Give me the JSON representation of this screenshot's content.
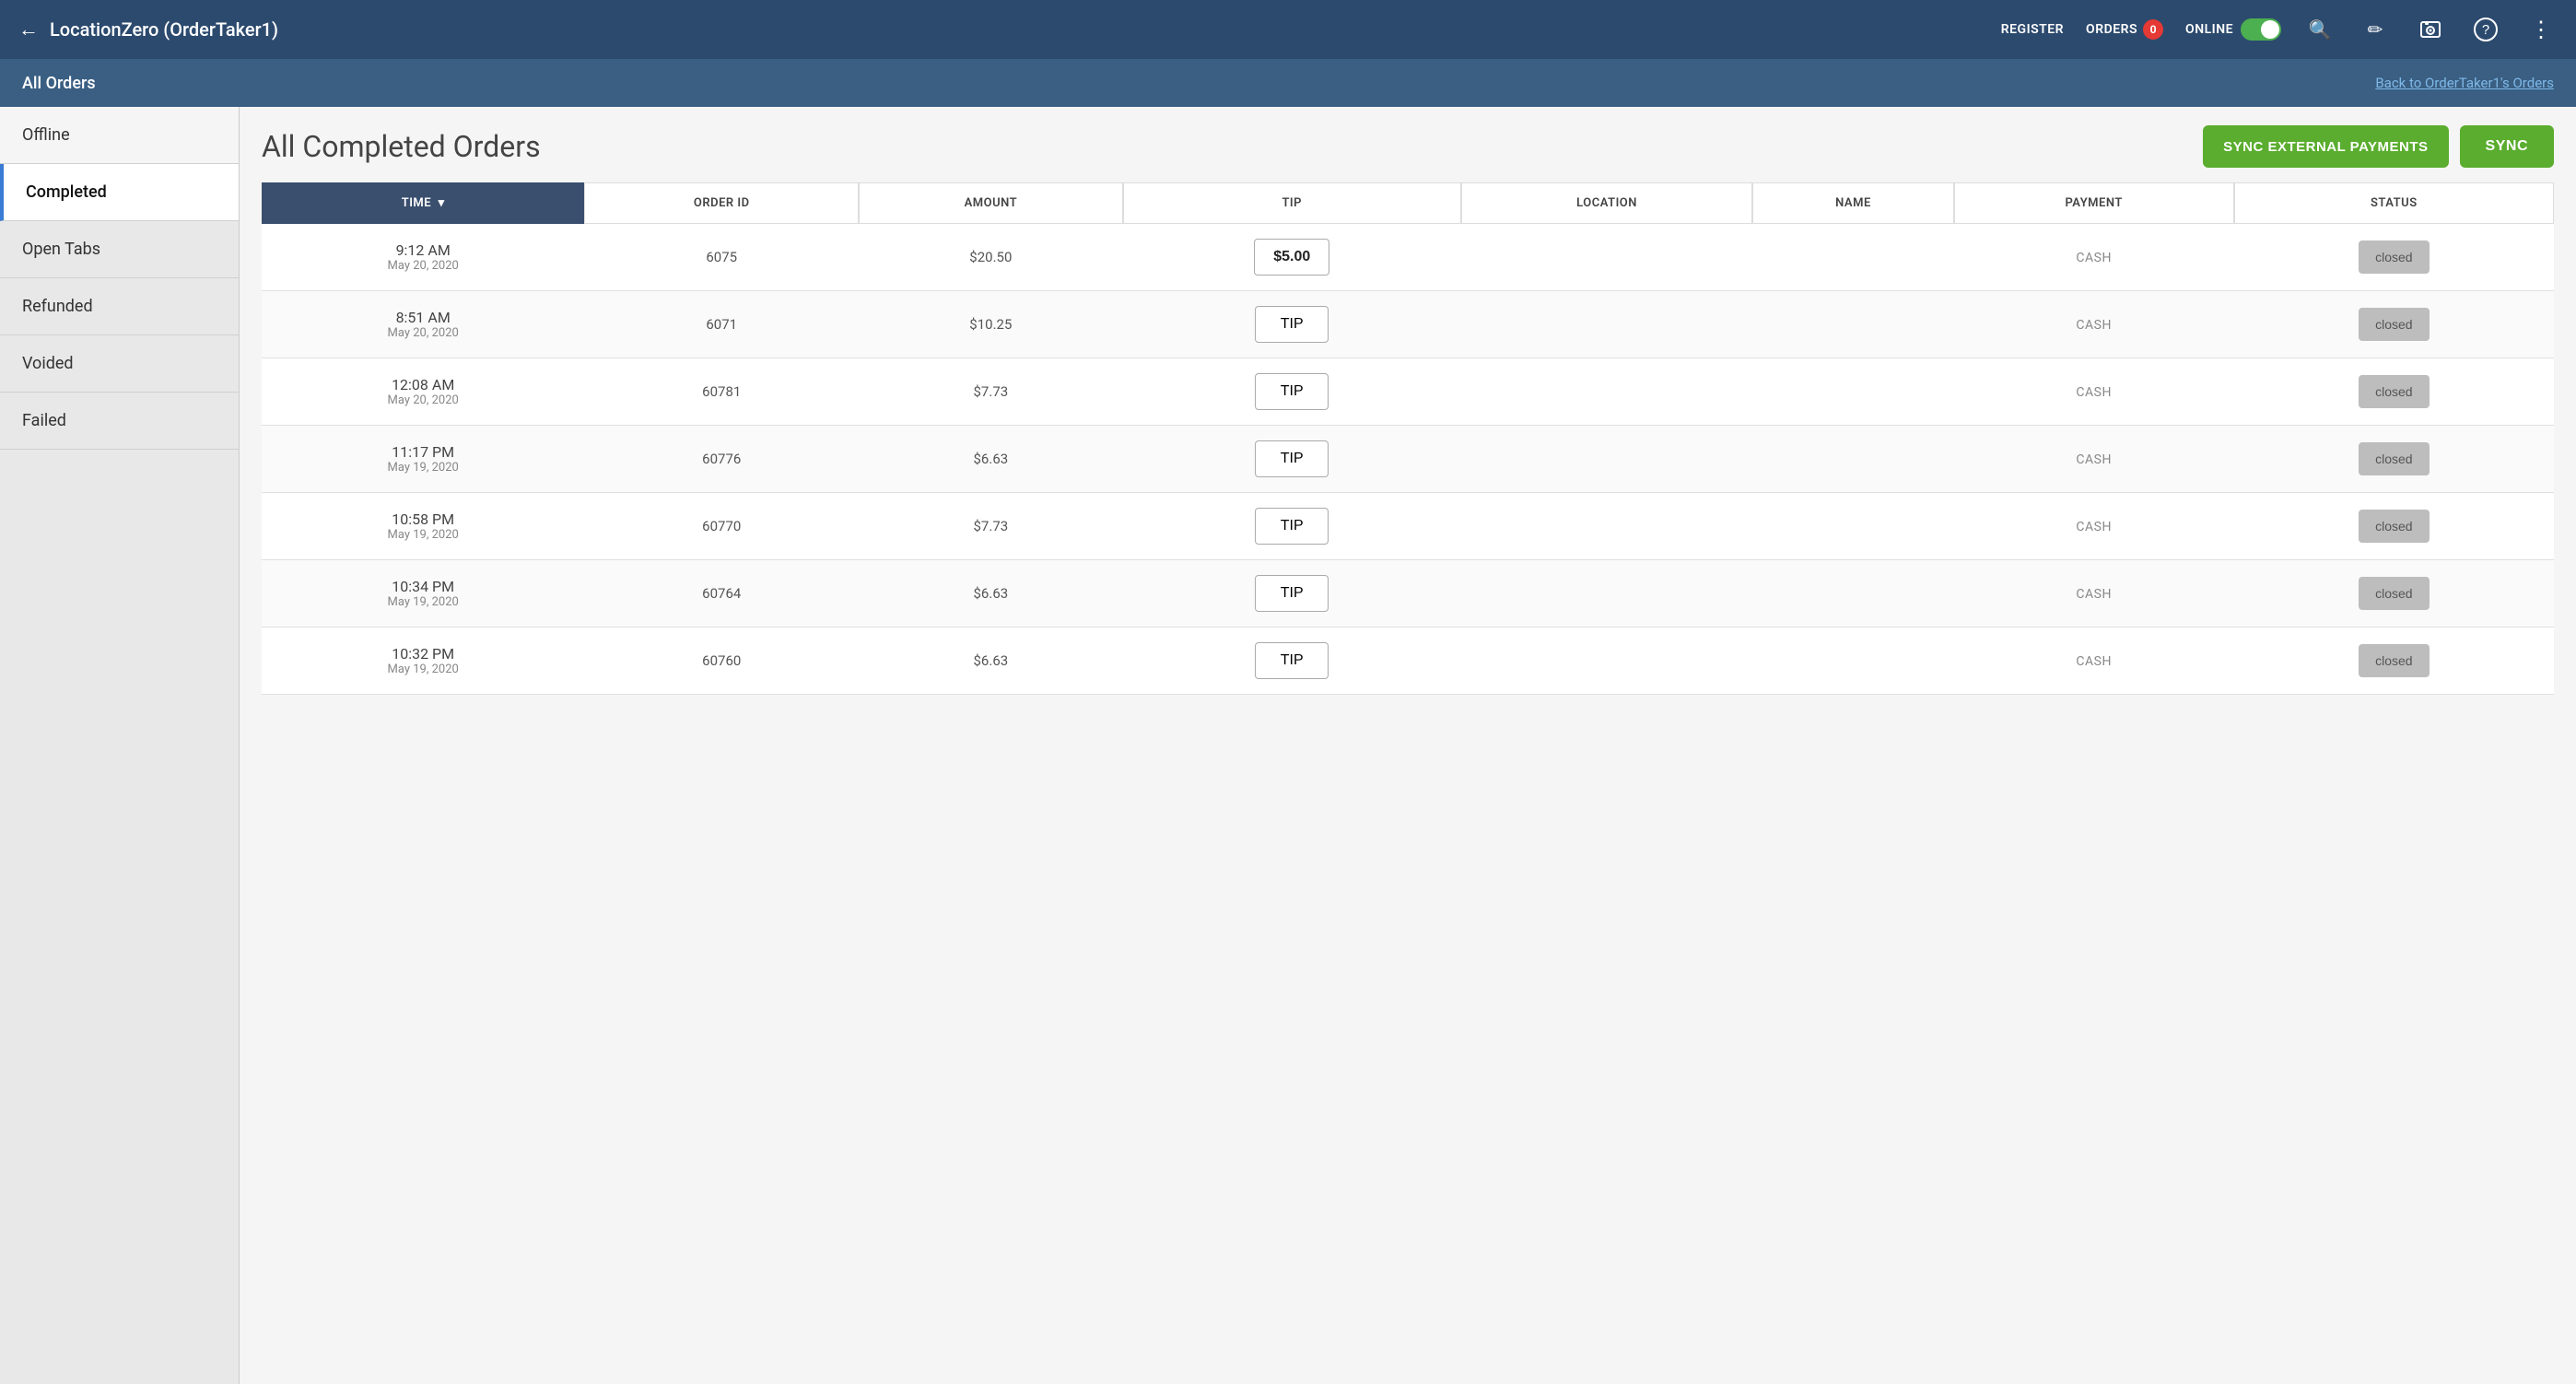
{
  "topNav": {
    "backArrow": "←",
    "title": "LocationZero (OrderTaker1)",
    "register": "REGISTER",
    "orders": "ORDERS",
    "ordersBadge": "0",
    "online": "ONLINE",
    "icons": {
      "search": "🔍",
      "pencil": "✏",
      "camera": "⬛",
      "help": "?",
      "more": "⋮"
    }
  },
  "subHeader": {
    "title": "All Orders",
    "backLink": "Back to OrderTaker1's Orders"
  },
  "sidebar": {
    "items": [
      {
        "label": "Offline",
        "active": false
      },
      {
        "label": "Completed",
        "active": true
      },
      {
        "label": "Open Tabs",
        "active": false
      },
      {
        "label": "Refunded",
        "active": false
      },
      {
        "label": "Voided",
        "active": false
      },
      {
        "label": "Failed",
        "active": false
      }
    ]
  },
  "content": {
    "title": "All Completed Orders",
    "syncExternalBtn": "SYNC EXTERNAL PAYMENTS",
    "syncBtn": "SYNC",
    "table": {
      "columns": [
        "TIME",
        "ORDER ID",
        "AMOUNT",
        "TIP",
        "LOCATION",
        "NAME",
        "PAYMENT",
        "STATUS"
      ],
      "rows": [
        {
          "timeMain": "9:12 AM",
          "timeSub": "May 20, 2020",
          "orderId": "6075",
          "amount": "$20.50",
          "tip": "$5.00",
          "tipHasValue": true,
          "location": "",
          "name": "",
          "payment": "CASH",
          "status": "closed"
        },
        {
          "timeMain": "8:51 AM",
          "timeSub": "May 20, 2020",
          "orderId": "6071",
          "amount": "$10.25",
          "tip": "TIP",
          "tipHasValue": false,
          "location": "",
          "name": "",
          "payment": "CASH",
          "status": "closed"
        },
        {
          "timeMain": "12:08 AM",
          "timeSub": "May 20, 2020",
          "orderId": "60781",
          "amount": "$7.73",
          "tip": "TIP",
          "tipHasValue": false,
          "location": "",
          "name": "",
          "payment": "CASH",
          "status": "closed"
        },
        {
          "timeMain": "11:17 PM",
          "timeSub": "May 19, 2020",
          "orderId": "60776",
          "amount": "$6.63",
          "tip": "TIP",
          "tipHasValue": false,
          "location": "",
          "name": "",
          "payment": "CASH",
          "status": "closed"
        },
        {
          "timeMain": "10:58 PM",
          "timeSub": "May 19, 2020",
          "orderId": "60770",
          "amount": "$7.73",
          "tip": "TIP",
          "tipHasValue": false,
          "location": "",
          "name": "",
          "payment": "CASH",
          "status": "closed"
        },
        {
          "timeMain": "10:34 PM",
          "timeSub": "May 19, 2020",
          "orderId": "60764",
          "amount": "$6.63",
          "tip": "TIP",
          "tipHasValue": false,
          "location": "",
          "name": "",
          "payment": "CASH",
          "status": "closed"
        },
        {
          "timeMain": "10:32 PM",
          "timeSub": "May 19, 2020",
          "orderId": "60760",
          "amount": "$6.63",
          "tip": "TIP",
          "tipHasValue": false,
          "location": "",
          "name": "",
          "payment": "CASH",
          "status": "closed"
        }
      ]
    }
  }
}
